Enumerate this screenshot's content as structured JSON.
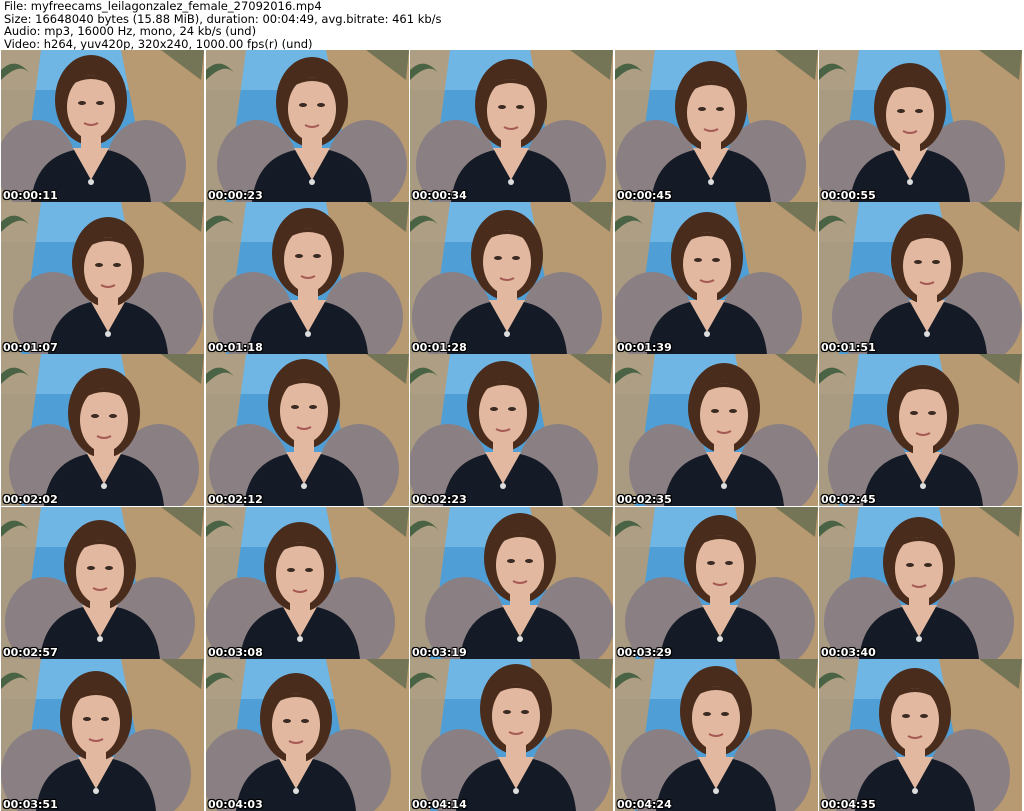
{
  "header": {
    "file_line": "File: myfreecams_leilagonzalez_female_27092016.mp4",
    "size_line": "Size: 16648040 bytes (15.88 MiB), duration: 00:04:49, avg.bitrate: 461 kb/s",
    "audio_line": "Audio: mp3, 16000 Hz, mono, 24 kb/s (und)",
    "video_line": "Video: h264, yuv420p, 320x240, 1000.00 fps(r) (und)"
  },
  "thumbnails": [
    {
      "timestamp": "00:00:11"
    },
    {
      "timestamp": "00:00:23"
    },
    {
      "timestamp": "00:00:34"
    },
    {
      "timestamp": "00:00:45"
    },
    {
      "timestamp": "00:00:55"
    },
    {
      "timestamp": "00:01:07"
    },
    {
      "timestamp": "00:01:18"
    },
    {
      "timestamp": "00:01:28"
    },
    {
      "timestamp": "00:01:39"
    },
    {
      "timestamp": "00:01:51"
    },
    {
      "timestamp": "00:02:02"
    },
    {
      "timestamp": "00:02:12"
    },
    {
      "timestamp": "00:02:23"
    },
    {
      "timestamp": "00:02:35"
    },
    {
      "timestamp": "00:02:45"
    },
    {
      "timestamp": "00:02:57"
    },
    {
      "timestamp": "00:03:08"
    },
    {
      "timestamp": "00:03:19"
    },
    {
      "timestamp": "00:03:29"
    },
    {
      "timestamp": "00:03:40"
    },
    {
      "timestamp": "00:03:51"
    },
    {
      "timestamp": "00:04:03"
    },
    {
      "timestamp": "00:04:14"
    },
    {
      "timestamp": "00:04:24"
    },
    {
      "timestamp": "00:04:35"
    }
  ],
  "colors": {
    "sky": "#4f9fd6",
    "pier": "#b89a72",
    "hair": "#4a2c1c",
    "skin": "#e2b9a0",
    "top": "#141a26",
    "chair": "#8a7f82"
  }
}
